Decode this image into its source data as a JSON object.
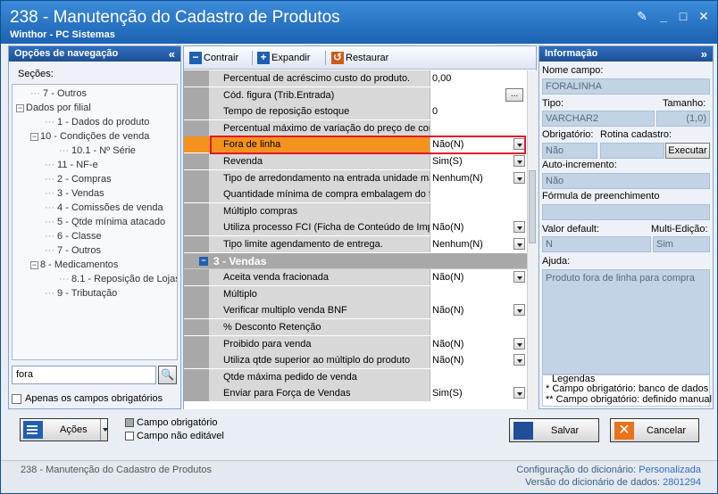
{
  "window": {
    "title": "238 - Manutenção do Cadastro de Produtos",
    "subtitle": "Winthor - PC Sistemas"
  },
  "nav": {
    "header": "Opções de navegação",
    "sections_label": "Seções:",
    "tree": [
      {
        "label": "7 - Outros",
        "indent": 1,
        "toggle": ""
      },
      {
        "label": "Dados por filial",
        "indent": 0,
        "toggle": "−"
      },
      {
        "label": "1 - Dados do produto",
        "indent": 2,
        "toggle": ""
      },
      {
        "label": "10 - Condições de venda",
        "indent": 1,
        "toggle": "−"
      },
      {
        "label": "10.1 - Nº Série",
        "indent": 3,
        "toggle": ""
      },
      {
        "label": "11 - NF-e",
        "indent": 2,
        "toggle": ""
      },
      {
        "label": "2 - Compras",
        "indent": 2,
        "toggle": ""
      },
      {
        "label": "3 - Vendas",
        "indent": 2,
        "toggle": ""
      },
      {
        "label": "4 - Comissões de venda",
        "indent": 2,
        "toggle": ""
      },
      {
        "label": "5 - Qtde mínima atacado",
        "indent": 2,
        "toggle": ""
      },
      {
        "label": "6 - Classe",
        "indent": 2,
        "toggle": ""
      },
      {
        "label": "7 - Outros",
        "indent": 2,
        "toggle": ""
      },
      {
        "label": "8 - Medicamentos",
        "indent": 1,
        "toggle": "−"
      },
      {
        "label": "8.1 - Reposição de Lojas",
        "indent": 3,
        "toggle": ""
      },
      {
        "label": "9 - Tributação",
        "indent": 2,
        "toggle": ""
      }
    ],
    "search_value": "fora",
    "only_required_label": "Apenas os campos obrigatórios"
  },
  "toolbar": {
    "collapse_label": "Contrair",
    "expand_label": "Expandir",
    "restore_label": "Restaurar"
  },
  "grid": {
    "rows": [
      {
        "label": "Percentual de acréscimo custo do produto.",
        "value": "0,00",
        "control": "none"
      },
      {
        "label": "Cód. figura (Trib.Entrada)",
        "value": "",
        "control": "ellipsis"
      },
      {
        "label": "Tempo de reposição estoque",
        "value": "0",
        "control": "none"
      },
      {
        "label": "Percentual máximo de variação do preço de compra",
        "value": "",
        "control": "none"
      },
      {
        "label": "Fora de linha",
        "value": "Não(N)",
        "control": "dropdown",
        "highlight": true
      },
      {
        "label": "Revenda",
        "value": "Sim(S)",
        "control": "dropdown"
      },
      {
        "label": "Tipo de arredondamento na entrada unidade master",
        "value": "Nenhum(N)",
        "control": "dropdown"
      },
      {
        "label": "Quantidade mínima de compra embalagem do fornecedor",
        "value": "",
        "control": "none"
      },
      {
        "label": "Múltiplo compras",
        "value": "",
        "control": "none"
      },
      {
        "label": "Utiliza processo FCI (Ficha de Conteúdo de Importação)",
        "value": "Não(N)",
        "control": "dropdown"
      },
      {
        "label": "Tipo limite agendamento de entrega.",
        "value": "Nenhum(N)",
        "control": "dropdown"
      }
    ],
    "category": "3 - Vendas",
    "category_rows": [
      {
        "label": "Aceita venda fracionada",
        "value": "Não(N)",
        "control": "dropdown"
      },
      {
        "label": "Múltiplo",
        "value": "",
        "control": "none"
      },
      {
        "label": "Verificar multiplo venda BNF",
        "value": "Não(N)",
        "control": "dropdown"
      },
      {
        "label": "% Desconto Retenção",
        "value": "",
        "control": "none"
      },
      {
        "label": "Proibido para venda",
        "value": "Não(N)",
        "control": "dropdown"
      },
      {
        "label": "Utiliza qtde superior ao múltiplo do produto",
        "value": "Não(N)",
        "control": "dropdown"
      },
      {
        "label": "Qtde máxima pedido de venda",
        "value": "",
        "control": "none"
      },
      {
        "label": "Enviar para Força de Vendas",
        "value": "Sim(S)",
        "control": "dropdown"
      }
    ]
  },
  "info": {
    "header": "Informação",
    "field_name_label": "Nome campo:",
    "field_name_value": "FORALINHA",
    "type_label": "Tipo:",
    "type_value": "VARCHAR2",
    "size_label": "Tamanho:",
    "size_value": "(1,0)",
    "required_label": "Obrigatório:",
    "required_value": "Não",
    "routine_label": "Rotina cadastro:",
    "execute_label": "Executar",
    "autoinc_label": "Auto-incremento:",
    "autoinc_value": "Não",
    "formula_label": "Fórmula de preenchimento",
    "default_label": "Valor default:",
    "default_value": "N",
    "multiedit_label": "Multi-Edição:",
    "multiedit_value": "Sim",
    "help_label": "Ajuda:",
    "help_value": "Produto fora de linha para compra",
    "legend_title": "Legendas",
    "legend_1": "* Campo obrigatório: banco de dados",
    "legend_2": "** Campo obrigatório: definido manual"
  },
  "bottom": {
    "actions_label": "Ações",
    "required_field_label": "Campo obrigatório",
    "not_editable_label": "Campo não editável",
    "save_label": "Salvar",
    "cancel_label": "Cancelar"
  },
  "status": {
    "left_text": "238 - Manutenção do Cadastro de Produtos",
    "dict_config_label": "Configuração do dicionário:",
    "dict_config_value": "Personalizada",
    "dict_version_label": "Versão do dicionário de dados:",
    "dict_version_value": "2801294"
  },
  "colors": {
    "highlight": "#f4921e",
    "highlight_border": "#e0182a",
    "title_bar": "#1c62b3"
  }
}
